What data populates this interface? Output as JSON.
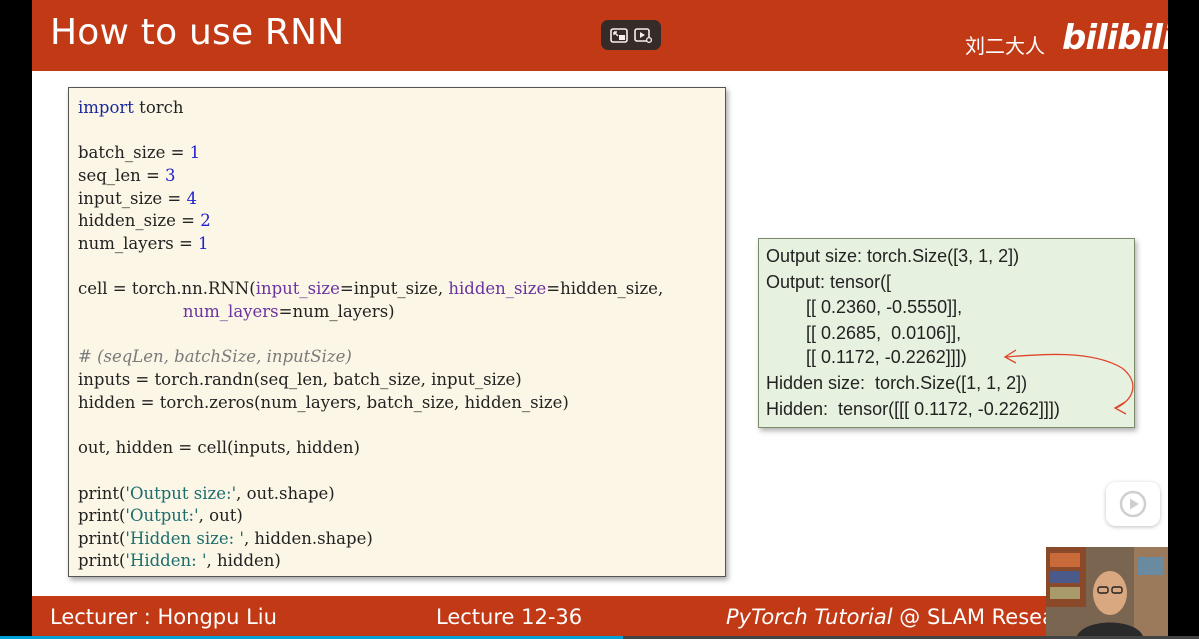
{
  "header": {
    "title": "How to use RNN",
    "brand": "刘二大人",
    "logo": "bilibili",
    "accent_color": "#c23a15"
  },
  "player_controls": [
    {
      "icon": "picture-in-picture-icon"
    },
    {
      "icon": "play-later-icon"
    }
  ],
  "code": {
    "lines": [
      "import torch",
      "batch_size = 1",
      "seq_len = 3",
      "input_size = 4",
      "hidden_size = 2",
      "num_layers = 1",
      "cell = torch.nn.RNN(input_size=input_size, hidden_size=hidden_size,",
      "                    num_layers=num_layers)",
      "# (seqLen, batchSize, inputSize)",
      "inputs = torch.randn(seq_len, batch_size, input_size)",
      "hidden = torch.zeros(num_layers, batch_size, hidden_size)",
      "out, hidden = cell(inputs, hidden)",
      "print('Output size:', out.shape)",
      "print('Output:', out)",
      "print('Hidden size: ', hidden.shape)",
      "print('Hidden: ', hidden)"
    ]
  },
  "output": {
    "lines": [
      "Output size: torch.Size([3, 1, 2])",
      "Output: tensor([",
      "        [[ 0.2360, -0.5550]],",
      "        [[ 0.2685,  0.0106]],",
      "        [[ 0.1172, -0.2262]]])",
      "Hidden size:  torch.Size([1, 1, 2])",
      "Hidden:  tensor([[[ 0.1172, -0.2262]]])"
    ],
    "annotation_color": "#e0442a"
  },
  "footer": {
    "lecturer": "Lecturer : Hongpu Liu",
    "lecture": "Lecture 12-36",
    "tutorial_italic": "PyTorch Tutorial",
    "tutorial_rest": " @ SLAM Resea"
  },
  "player": {
    "progress_fraction": 0.52,
    "progress_color": "#00a1d6",
    "play_icon": "play-icon"
  }
}
